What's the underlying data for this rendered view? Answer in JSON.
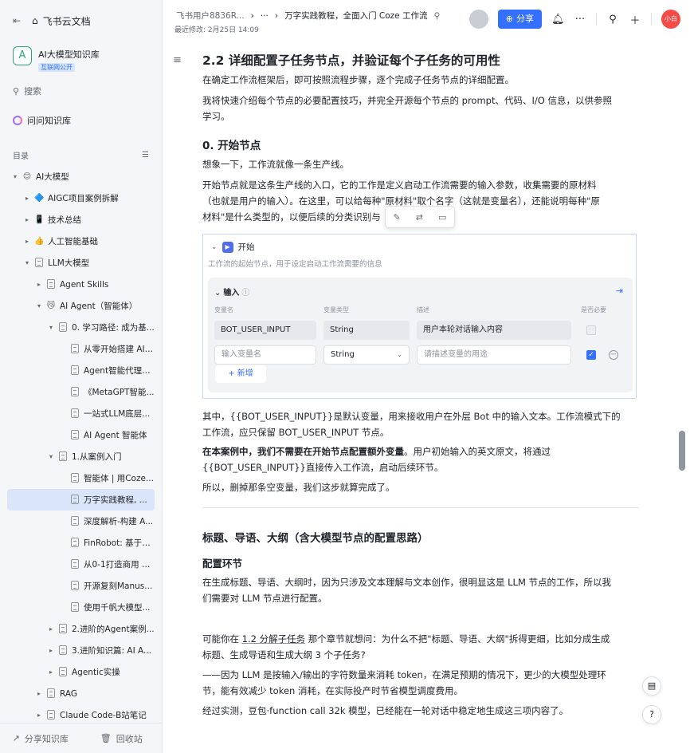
{
  "app": {
    "name": "飞书云文档"
  },
  "sidebar": {
    "kb_title": "AI大模型知识库",
    "kb_badge": "互联网公开",
    "search_label": "搜索",
    "qa_label": "问问知识库",
    "toc_label": "目录",
    "tree": [
      {
        "label": "AI大模型",
        "depth": 0,
        "arrow": "▾",
        "icon": "😊"
      },
      {
        "label": "AIGC项目案例拆解",
        "depth": 1,
        "arrow": "▸",
        "icon": "🔷"
      },
      {
        "label": "技术总结",
        "depth": 1,
        "arrow": "▸",
        "icon": "📱"
      },
      {
        "label": "人工智能基础",
        "depth": 1,
        "arrow": "▸",
        "icon": "👍"
      },
      {
        "label": "LLM大模型",
        "depth": 1,
        "arrow": "▾",
        "icon": "doc"
      },
      {
        "label": "Agent Skills",
        "depth": 2,
        "arrow": "▸",
        "icon": "doc"
      },
      {
        "label": "AI Agent（智能体）",
        "depth": 2,
        "arrow": "▾",
        "icon": "😼"
      },
      {
        "label": "0. 学习路径: 成为基...",
        "depth": 3,
        "arrow": "▾",
        "icon": "doc"
      },
      {
        "label": "从零开始搭建 AI ...",
        "depth": 4,
        "arrow": "",
        "icon": "doc"
      },
      {
        "label": "Agent智能代理开...",
        "depth": 4,
        "arrow": "",
        "icon": "doc"
      },
      {
        "label": "《MetaGPT智能...",
        "depth": 4,
        "arrow": "",
        "icon": "doc"
      },
      {
        "label": "一站式LLM底层...",
        "depth": 4,
        "arrow": "",
        "icon": "doc"
      },
      {
        "label": "AI Agent 智能体",
        "depth": 4,
        "arrow": "",
        "icon": "doc"
      },
      {
        "label": "1.从案例入门",
        "depth": 3,
        "arrow": "▾",
        "icon": "doc"
      },
      {
        "label": "智能体 | 用Coze...",
        "depth": 4,
        "arrow": "",
        "icon": "doc"
      },
      {
        "label": "万字实践教程, ...",
        "depth": 4,
        "arrow": "",
        "icon": "doc",
        "selected": true
      },
      {
        "label": "深度解析-构建 A...",
        "depth": 4,
        "arrow": "",
        "icon": "doc"
      },
      {
        "label": "FinRobot: 基于L...",
        "depth": 4,
        "arrow": "",
        "icon": "doc"
      },
      {
        "label": "从0-1打造商用 A...",
        "depth": 4,
        "arrow": "",
        "icon": "doc"
      },
      {
        "label": "开源复刻Manus...",
        "depth": 4,
        "arrow": "",
        "icon": "doc"
      },
      {
        "label": "使用千帆大模型...",
        "depth": 4,
        "arrow": "",
        "icon": "doc"
      },
      {
        "label": "2.进阶的Agent案例...",
        "depth": 3,
        "arrow": "▸",
        "icon": "doc"
      },
      {
        "label": "3.进阶知识篇: AI A...",
        "depth": 3,
        "arrow": "▸",
        "icon": "doc"
      },
      {
        "label": "Agentic实操",
        "depth": 3,
        "arrow": "▸",
        "icon": "doc"
      },
      {
        "label": "RAG",
        "depth": 2,
        "arrow": "▸",
        "icon": "doc"
      },
      {
        "label": "Claude Code-B站笔记",
        "depth": 2,
        "arrow": "▸",
        "icon": "doc"
      }
    ],
    "bottom": {
      "share": "分享知识库",
      "recycle": "回收站"
    }
  },
  "header": {
    "crumb_user": "飞书用户8836R...",
    "crumb_more": "···",
    "crumb_title": "万字实践教程，全面入门 Coze 工作流",
    "last_modified": "最近修改: 2月25日 14:09",
    "share_label": "分享",
    "user_initials": "小白"
  },
  "doc": {
    "h_2_2": "2.2 详细配置子任务节点，并验证每个子任务的可用性",
    "p1": "在确定工作流框架后，即可按照流程步骤，逐个完成子任务节点的详细配置。",
    "p2a": "我将快速介绍每个节点的必要配置技巧，并完全开源每个节点的 prompt、代码、I/O 信息，以供参照",
    "p2b": "学习。",
    "h_start": "0. 开始节点",
    "p3": "想象一下，工作流就像一条生产线。",
    "p4a": "开始节点就是这条生产线的入口，它的工作是定义启动工作流需要的输入参数，收集需要的原材料",
    "p4b": "（也就是用户的输入）。在这里，可以给每种\"原材料\"取个名字（这就是变量名），还能说明每种\"原",
    "p4c": "材料\"是什么类型的，以便后续的分类识别与",
    "wf": {
      "title": "开始",
      "desc": "工作流的起始节点，用于设定启动工作流需要的信息",
      "input_title": "输入",
      "input_info": "ⓘ",
      "col_name": "变量名",
      "col_type": "变量类型",
      "col_desc": "描述",
      "col_required": "是否必要",
      "row1": {
        "name": "BOT_USER_INPUT",
        "type": "String",
        "desc": "用户本轮对话输入内容"
      },
      "row2": {
        "name_ph": "输入变量名",
        "type": "String",
        "desc_ph": "请描述变量的用途"
      },
      "add_label": "+ 新增"
    },
    "p5a": "其中，{{BOT_USER_INPUT}}是默认变量，用来接收用户在外层 Bot 中的输入文本。工作流模式下的",
    "p5b": "工作流，应只保留 BOT_USER_INPUT 节点。",
    "p6_bold": "在本案例中，我们不需要在开始节点配置额外变量",
    "p6_rest": "。用户初始输入的英文原文，将通过",
    "p6b": "{{BOT_USER_INPUT}}直接传入工作流，启动后续环节。",
    "p7": "所以，删掉那条空变量，我们这步就算完成了。",
    "h_title": "标题、导语、大纲（含大模型节点的配置思路）",
    "h_config": "配置环节",
    "p8a": "在生成标题、导语、大纲时，因为只涉及文本理解与文本创作，很明显这是 LLM 节点的工作，所以我",
    "p8b": "们需要对 LLM 节点进行配置。",
    "p9_pre": "可能你在 ",
    "p9_link": "1.2 分解子任务",
    "p9_post": " 那个章节就想问：为什么不把\"标题、导语、大纲\"拆得更细，比如分成生成",
    "p9b": "标题、生成导语和生成大纲 3 个子任务?",
    "p10a": "——因为 LLM 是按输入/输出的字符数量来消耗 token，在满足预期的情况下，更少的大模型处理环",
    "p10b": "节，能有效减少 token 消耗，在实际投产时节省模型调度费用。",
    "p11": "经过实测，豆包·function call 32k 模型，已经能在一轮对话中稳定地生成这三项内容了。"
  },
  "icons": {
    "sidebar_toggle": "sidebar-toggle-icon",
    "home": "home-icon",
    "search": "search-icon",
    "bell": "bell-icon",
    "more": "more-icon",
    "add": "add-icon",
    "globe": "globe-icon"
  },
  "colors": {
    "accent": "#3370ff",
    "selected_bg": "#dbe5fa",
    "brand_green": "#2aa57a"
  }
}
